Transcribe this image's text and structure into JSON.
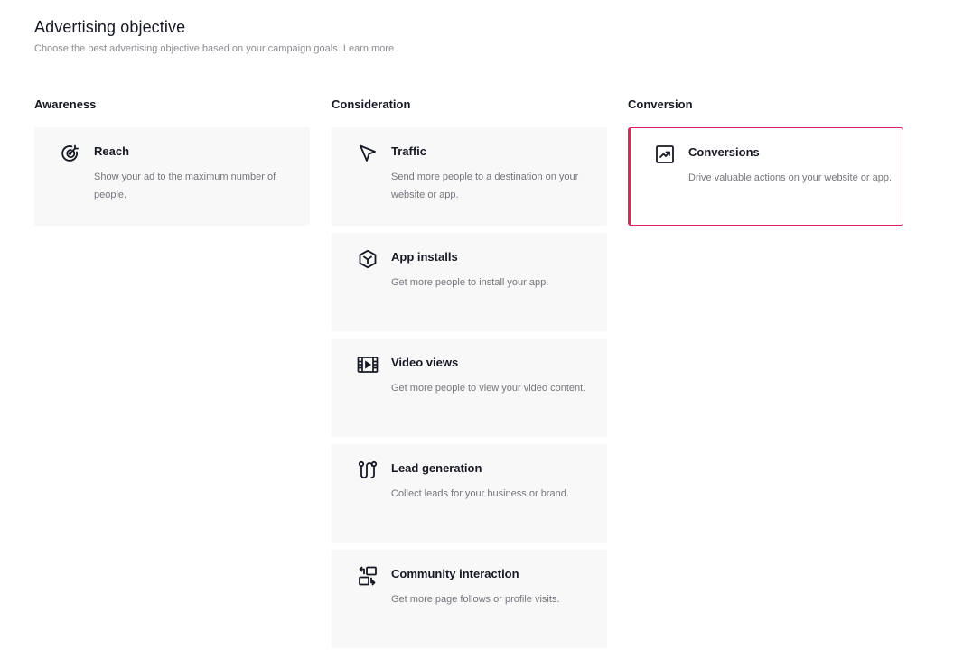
{
  "header": {
    "title": "Advertising objective",
    "subtitle": "Choose the best advertising objective based on your campaign goals.",
    "learn_more": "Learn more"
  },
  "columns": {
    "awareness": {
      "heading": "Awareness",
      "cards": [
        {
          "title": "Reach",
          "description": "Show your ad to the maximum number of people.",
          "icon": "reach-target-icon"
        }
      ]
    },
    "consideration": {
      "heading": "Consideration",
      "cards": [
        {
          "title": "Traffic",
          "description": "Send more people to a destination on your website or app.",
          "icon": "cursor-arrow-icon"
        },
        {
          "title": "App installs",
          "description": "Get more people to install your app.",
          "icon": "app-cube-icon"
        },
        {
          "title": "Video views",
          "description": "Get more people to view your video content.",
          "icon": "film-play-icon"
        },
        {
          "title": "Lead generation",
          "description": "Collect leads for your business or brand.",
          "icon": "funnel-path-icon"
        },
        {
          "title": "Community interaction",
          "description": "Get more page follows or profile visits.",
          "icon": "community-swap-icon"
        }
      ]
    },
    "conversion": {
      "heading": "Conversion",
      "cards": [
        {
          "title": "Conversions",
          "description": "Drive valuable actions on your website or app.",
          "icon": "trend-chart-icon",
          "selected": true
        }
      ]
    }
  },
  "colors": {
    "accent": "#e0245e",
    "card_bg": "#f8f8f8",
    "text_primary": "#161823",
    "text_secondary": "#75767d"
  }
}
